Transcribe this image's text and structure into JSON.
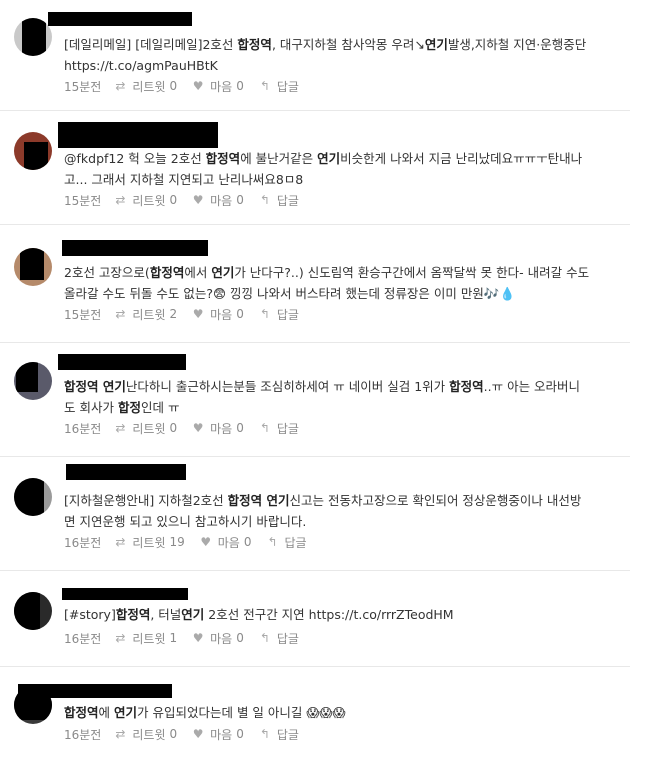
{
  "tweets": [
    {
      "time": "15분전",
      "retweet_label": "리트윗",
      "retweet_count": "0",
      "fav_label": "마음",
      "fav_count": "0",
      "reply_label": "답글",
      "line1": [
        {
          "t": "[데일리메일] [데일리메일]2호선 "
        },
        {
          "t": "합정역",
          "b": true
        },
        {
          "t": ", 대구지하철 참사악몽 우려↘"
        },
        {
          "t": "연기",
          "b": true
        },
        {
          "t": "발생,지하철 지연·운행중단"
        }
      ],
      "line2": [
        {
          "t": "https://t.co/agmPauHBtK"
        }
      ]
    },
    {
      "time": "15분전",
      "retweet_label": "리트윗",
      "retweet_count": "0",
      "fav_label": "마음",
      "fav_count": "0",
      "reply_label": "답글",
      "line1": [
        {
          "t": "@fkdpf12 헉 오늘 2호선 "
        },
        {
          "t": "합정역",
          "b": true
        },
        {
          "t": "에 불난거같은 "
        },
        {
          "t": "연기",
          "b": true
        },
        {
          "t": "비슷한게 나와서 지금 난리났데요ㅠㅠㅜ탄내나"
        }
      ],
      "line2": [
        {
          "t": "고... 그래서 지하철 지연되고 난리나써요8ㅁ8"
        }
      ]
    },
    {
      "time": "15분전",
      "retweet_label": "리트윗",
      "retweet_count": "2",
      "fav_label": "마음",
      "fav_count": "0",
      "reply_label": "답글",
      "line1": [
        {
          "t": "2호선 고장으로("
        },
        {
          "t": "합정역",
          "b": true
        },
        {
          "t": "에서 "
        },
        {
          "t": "연기",
          "b": true
        },
        {
          "t": "가 난다구?..) 신도림역 환승구간에서 옴짝달싹 못 한다- 내려갈 수도"
        }
      ],
      "line2": [
        {
          "t": "올라갈 수도 뒤돌 수도 없는?😨 낑낑 나와서 버스타려 했는데 정류장은 이미 만원🎶💧"
        }
      ]
    },
    {
      "time": "16분전",
      "retweet_label": "리트윗",
      "retweet_count": "0",
      "fav_label": "마음",
      "fav_count": "0",
      "reply_label": "답글",
      "line1": [
        {
          "t": "합정역 연기",
          "b": true
        },
        {
          "t": "난다하니 출근하시는분들 조심히하세여 ㅠ 네이버 실검 1위가 "
        },
        {
          "t": "합정역",
          "b": true
        },
        {
          "t": "..ㅠ 아는 오라버니"
        }
      ],
      "line2": [
        {
          "t": "도 회사가 "
        },
        {
          "t": "합정",
          "b": true
        },
        {
          "t": "인데 ㅠ"
        }
      ]
    },
    {
      "time": "16분전",
      "retweet_label": "리트윗",
      "retweet_count": "19",
      "fav_label": "마음",
      "fav_count": "0",
      "reply_label": "답글",
      "line1": [
        {
          "t": "[지하철운행안내] 지하철2호선 "
        },
        {
          "t": "합정역 연기",
          "b": true
        },
        {
          "t": "신고는 전동차고장으로 확인되어 정상운행중이나 내선방"
        }
      ],
      "line2": [
        {
          "t": "면 지연운행 되고 있으니 참고하시기 바랍니다."
        }
      ]
    },
    {
      "time": "16분전",
      "retweet_label": "리트윗",
      "retweet_count": "1",
      "fav_label": "마음",
      "fav_count": "0",
      "reply_label": "답글",
      "line1": [
        {
          "t": "[#story]"
        },
        {
          "t": "합정역",
          "b": true
        },
        {
          "t": ", 터널"
        },
        {
          "t": "연기",
          "b": true
        },
        {
          "t": " 2호선 전구간 지연 https://t.co/rrrZTeodHM"
        }
      ],
      "line2": []
    },
    {
      "time": "16분전",
      "retweet_label": "리트윗",
      "retweet_count": "0",
      "fav_label": "마음",
      "fav_count": "0",
      "reply_label": "답글",
      "line1": [
        {
          "t": "합정역",
          "b": true
        },
        {
          "t": "에 "
        },
        {
          "t": "연기",
          "b": true
        },
        {
          "t": "가 유입되었다는데 별 일 아니길 😱😱😱"
        }
      ],
      "line2": []
    }
  ]
}
